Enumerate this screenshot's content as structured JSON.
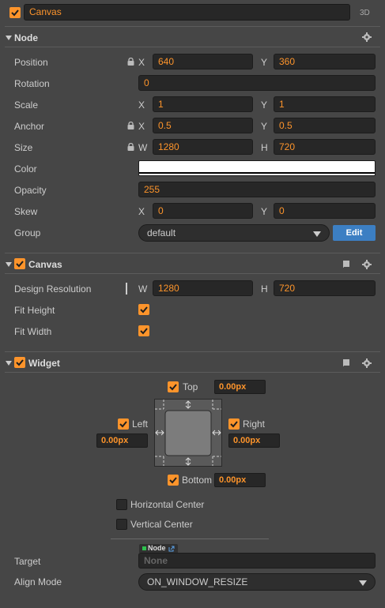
{
  "header": {
    "active_checked": true,
    "name": "Canvas",
    "mode_label": "3D"
  },
  "node_section": {
    "title": "Node",
    "position": {
      "label": "Position",
      "x_axis": "X",
      "x": "640",
      "y_axis": "Y",
      "y": "360"
    },
    "rotation": {
      "label": "Rotation",
      "value": "0"
    },
    "scale": {
      "label": "Scale",
      "x_axis": "X",
      "x": "1",
      "y_axis": "Y",
      "y": "1"
    },
    "anchor": {
      "label": "Anchor",
      "x_axis": "X",
      "x": "0.5",
      "y_axis": "Y",
      "y": "0.5"
    },
    "size": {
      "label": "Size",
      "w_axis": "W",
      "w": "1280",
      "h_axis": "H",
      "h": "720"
    },
    "color": {
      "label": "Color",
      "value": "#ffffff"
    },
    "opacity": {
      "label": "Opacity",
      "value": "255"
    },
    "skew": {
      "label": "Skew",
      "x_axis": "X",
      "x": "0",
      "y_axis": "Y",
      "y": "0"
    },
    "group": {
      "label": "Group",
      "value": "default",
      "edit_label": "Edit"
    }
  },
  "canvas_section": {
    "title": "Canvas",
    "enabled": true,
    "design_resolution": {
      "label": "Design Resolution",
      "w_axis": "W",
      "w": "1280",
      "h_axis": "H",
      "h": "720"
    },
    "fit_height": {
      "label": "Fit Height",
      "checked": true
    },
    "fit_width": {
      "label": "Fit Width",
      "checked": true
    }
  },
  "widget_section": {
    "title": "Widget",
    "enabled": true,
    "top": {
      "label": "Top",
      "checked": true,
      "value": "0.00px"
    },
    "left": {
      "label": "Left",
      "checked": true,
      "value": "0.00px"
    },
    "right": {
      "label": "Right",
      "checked": true,
      "value": "0.00px"
    },
    "bottom": {
      "label": "Bottom",
      "checked": true,
      "value": "0.00px"
    },
    "horizontal_center": {
      "label": "Horizontal Center",
      "checked": false
    },
    "vertical_center": {
      "label": "Vertical Center",
      "checked": false
    },
    "target": {
      "label": "Target",
      "type_badge": "Node",
      "placeholder": "None"
    },
    "align_mode": {
      "label": "Align Mode",
      "value": "ON_WINDOW_RESIZE"
    }
  },
  "colors": {
    "accent": "#fd942b",
    "panel_bg": "#464646",
    "field_bg": "#272727",
    "edit_button": "#3c7fc3"
  }
}
